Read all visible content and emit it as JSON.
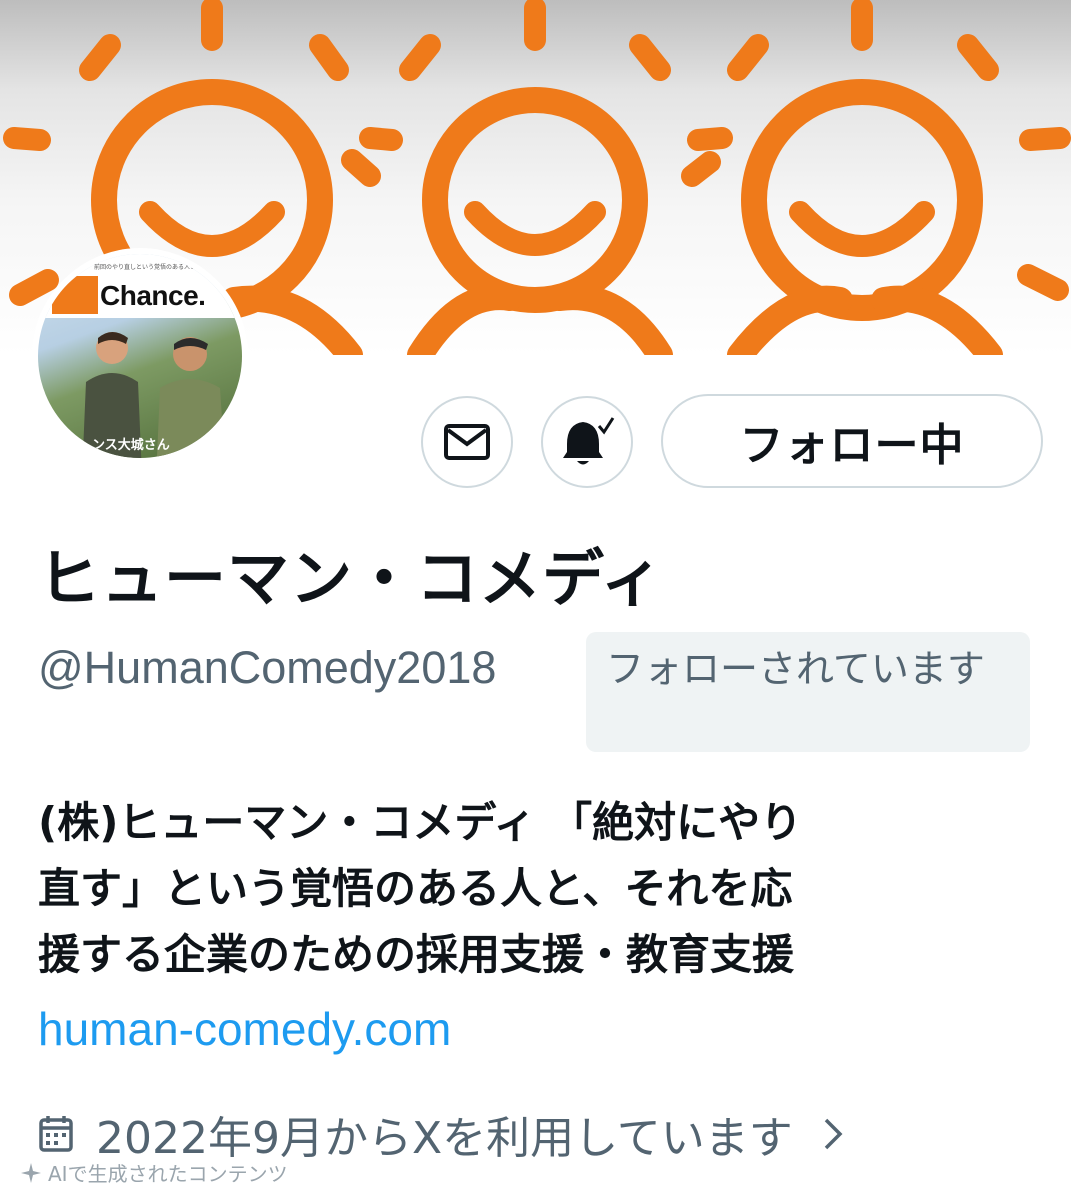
{
  "banner": {
    "icon": "sun-faces-banner",
    "accent": "#ef7a1a"
  },
  "avatar": {
    "logo_text": "Chance.",
    "tagline": "前回のやり直しという覚悟のある人と…",
    "caption": "ンス大城さん"
  },
  "actions": {
    "message_icon": "mail-icon",
    "notify_icon": "bell-icon",
    "follow_label": "フォロー中"
  },
  "profile": {
    "display_name": "ヒューマン・コメディ",
    "handle": "@HumanComedy2018",
    "follows_you": "フォローされています",
    "bio": "(株)ヒューマン・コメディ 「絶対にやり\n直す」という覚悟のある人と、それを応\n援する企業のための採用支援・教育支援",
    "link": "human-comedy.com",
    "joined": "2022年9月からXを利用しています"
  },
  "watermark": {
    "text": "AIで生成されたコンテンツ"
  },
  "colors": {
    "link": "#1d9bf0",
    "muted": "#536471",
    "text": "#0f1419",
    "border": "#cfd9de"
  }
}
